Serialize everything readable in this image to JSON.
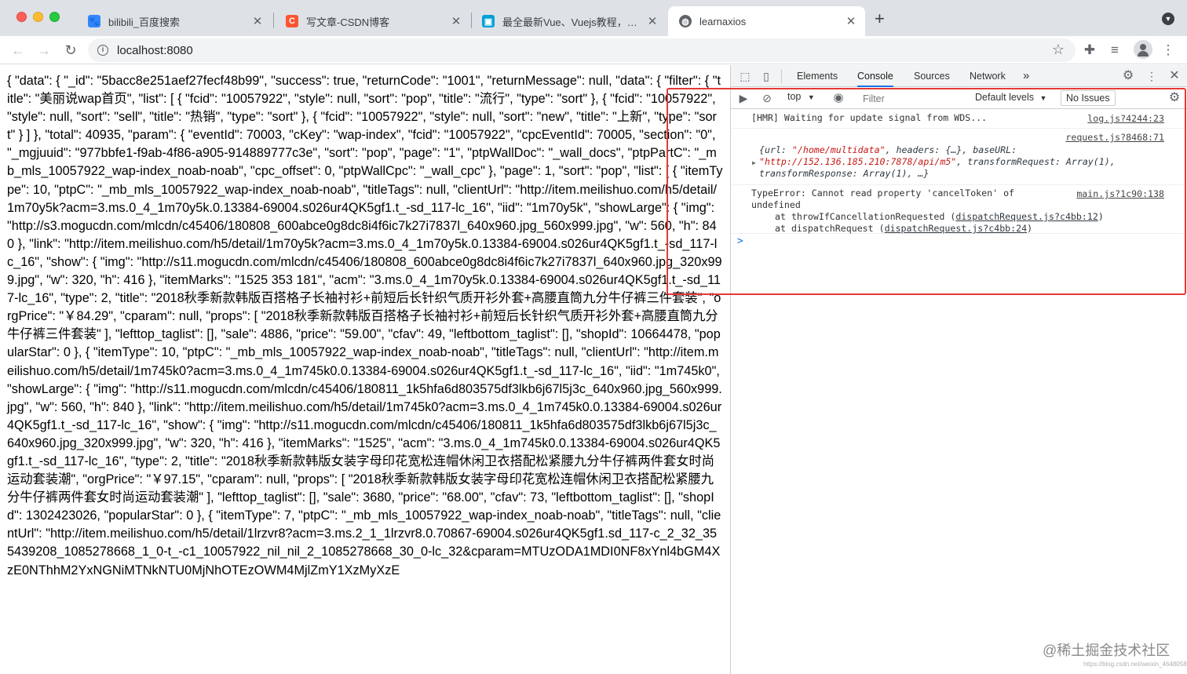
{
  "browser": {
    "tabs": [
      {
        "title": "bilibili_百度搜索",
        "favicon": "paw-icon",
        "color": "#3385ff"
      },
      {
        "title": "写文章-CSDN博客",
        "favicon": "csdn-icon",
        "color": "#fc5531"
      },
      {
        "title": "最全最新Vue、Vuejs教程，从入门到精通",
        "favicon": "tv-icon",
        "color": "#00a1d6"
      },
      {
        "title": "learnaxios",
        "favicon": "globe-icon",
        "color": "#5f6368"
      }
    ],
    "new_tab": "+",
    "url": "localhost:8080"
  },
  "page": {
    "json_text": "{ \"data\": { \"_id\": \"5bacc8e251aef27fecf48b99\", \"success\": true, \"returnCode\": \"1001\", \"returnMessage\": null, \"data\": { \"filter\": { \"title\": \"美丽说wap首页\", \"list\": [ { \"fcid\": \"10057922\", \"style\": null, \"sort\": \"pop\", \"title\": \"流行\", \"type\": \"sort\" }, { \"fcid\": \"10057922\", \"style\": null, \"sort\": \"sell\", \"title\": \"热销\", \"type\": \"sort\" }, { \"fcid\": \"10057922\", \"style\": null, \"sort\": \"new\", \"title\": \"上新\", \"type\": \"sort\" } ] }, \"total\": 40935, \"param\": { \"eventId\": 70003, \"cKey\": \"wap-index\", \"fcid\": \"10057922\", \"cpcEventId\": 70005, \"section\": \"0\", \"_mgjuuid\": \"977bbfe1-f9ab-4f86-a905-914889777c3e\", \"sort\": \"pop\", \"page\": \"1\", \"ptpWallDoc\": \"_wall_docs\", \"ptpPartC\": \"_mb_mls_10057922_wap-index_noab-noab\", \"cpc_offset\": 0, \"ptpWallCpc\": \"_wall_cpc\" }, \"page\": 1, \"sort\": \"pop\", \"list\": [ { \"itemType\": 10, \"ptpC\": \"_mb_mls_10057922_wap-index_noab-noab\", \"titleTags\": null, \"clientUrl\": \"http://item.meilishuo.com/h5/detail/1m70y5k?acm=3.ms.0_4_1m70y5k.0.13384-69004.s026ur4QK5gf1.t_-sd_117-lc_16\", \"iid\": \"1m70y5k\", \"showLarge\": { \"img\": \"http://s3.mogucdn.com/mlcdn/c45406/180808_600abce0g8dc8i4f6ic7k27i7837l_640x960.jpg_560x999.jpg\", \"w\": 560, \"h\": 840 }, \"link\": \"http://item.meilishuo.com/h5/detail/1m70y5k?acm=3.ms.0_4_1m70y5k.0.13384-69004.s026ur4QK5gf1.t_-sd_117-lc_16\", \"show\": { \"img\": \"http://s11.mogucdn.com/mlcdn/c45406/180808_600abce0g8dc8i4f6ic7k27i7837l_640x960.jpg_320x999.jpg\", \"w\": 320, \"h\": 416 }, \"itemMarks\": \"1525 353 181\", \"acm\": \"3.ms.0_4_1m70y5k.0.13384-69004.s026ur4QK5gf1.t_-sd_117-lc_16\", \"type\": 2, \"title\": \"2018秋季新款韩版百搭格子长袖衬衫+前短后长针织气质开衫外套+高腰直筒九分牛仔裤三件套装\", \"orgPrice\": \"￥84.29\", \"cparam\": null, \"props\": [ \"2018秋季新款韩版百搭格子长袖衬衫+前短后长针织气质开衫外套+高腰直筒九分牛仔裤三件套装\" ], \"lefttop_taglist\": [], \"sale\": 4886, \"price\": \"59.00\", \"cfav\": 49, \"leftbottom_taglist\": [], \"shopId\": 10664478, \"popularStar\": 0 }, { \"itemType\": 10, \"ptpC\": \"_mb_mls_10057922_wap-index_noab-noab\", \"titleTags\": null, \"clientUrl\": \"http://item.meilishuo.com/h5/detail/1m745k0?acm=3.ms.0_4_1m745k0.0.13384-69004.s026ur4QK5gf1.t_-sd_117-lc_16\", \"iid\": \"1m745k0\", \"showLarge\": { \"img\": \"http://s11.mogucdn.com/mlcdn/c45406/180811_1k5hfa6d803575df3lkb6j67l5j3c_640x960.jpg_560x999.jpg\", \"w\": 560, \"h\": 840 }, \"link\": \"http://item.meilishuo.com/h5/detail/1m745k0?acm=3.ms.0_4_1m745k0.0.13384-69004.s026ur4QK5gf1.t_-sd_117-lc_16\", \"show\": { \"img\": \"http://s11.mogucdn.com/mlcdn/c45406/180811_1k5hfa6d803575df3lkb6j67l5j3c_640x960.jpg_320x999.jpg\", \"w\": 320, \"h\": 416 }, \"itemMarks\": \"1525\", \"acm\": \"3.ms.0_4_1m745k0.0.13384-69004.s026ur4QK5gf1.t_-sd_117-lc_16\", \"type\": 2, \"title\": \"2018秋季新款韩版女装字母印花宽松连帽休闲卫衣搭配松紧腰九分牛仔裤两件套女时尚运动套装潮\", \"orgPrice\": \"￥97.15\", \"cparam\": null, \"props\": [ \"2018秋季新款韩版女装字母印花宽松连帽休闲卫衣搭配松紧腰九分牛仔裤两件套女时尚运动套装潮\" ], \"lefttop_taglist\": [], \"sale\": 3680, \"price\": \"68.00\", \"cfav\": 73, \"leftbottom_taglist\": [], \"shopId\": 1302423026, \"popularStar\": 0 }, { \"itemType\": 7, \"ptpC\": \"_mb_mls_10057922_wap-index_noab-noab\", \"titleTags\": null, \"clientUrl\": \"http://item.meilishuo.com/h5/detail/1lrzvr8?acm=3.ms.2_1_1lrzvr8.0.70867-69004.s026ur4QK5gf1.sd_117-c_2_32_355439208_1085278668_1_0-t_-c1_10057922_nil_nil_2_1085278668_30_0-lc_32&cparam=MTUzODA1MDI0NF8xYnl4bGM4XzE0NThhM2YxNGNiMTNkNTU0MjNhOTEzOWM4MjlZmY1XzMyXzE"
  },
  "devtools": {
    "tabs": [
      "Elements",
      "Console",
      "Sources",
      "Network"
    ],
    "more": "»",
    "context": "top",
    "filter_placeholder": "Filter",
    "levels": "Default levels",
    "issues": "No Issues",
    "messages": {
      "hmr_text": "[HMR] Waiting for update signal from WDS...",
      "hmr_source": "log.js?4244:23",
      "obj_source": "request.js?8468:71",
      "obj_open": "{url: ",
      "obj_url": "\"/home/multidata\"",
      "obj_mid": ", headers: {…}, baseURL: ",
      "obj_base": "\"http://152.136.185.210:7878/api/m5\"",
      "obj_tail": ", transformRequest: Array(1), transformResponse: Array(1), …}",
      "err_text": "TypeError: Cannot read property 'cancelToken' of undefined",
      "err_source": "main.js?1c90:138",
      "stack1_prefix": "at throwIfCancellationRequested (",
      "stack1_link": "dispatchRequest.js?c4bb:12",
      "stack2_prefix": "at dispatchRequest (",
      "stack2_link": "dispatchRequest.js?c4bb:24",
      "close_paren": ")"
    },
    "prompt": ">"
  },
  "watermark": {
    "text": "@稀土掘金技术社区",
    "sub": "https://blog.csdn.net/weixin_46480580"
  }
}
